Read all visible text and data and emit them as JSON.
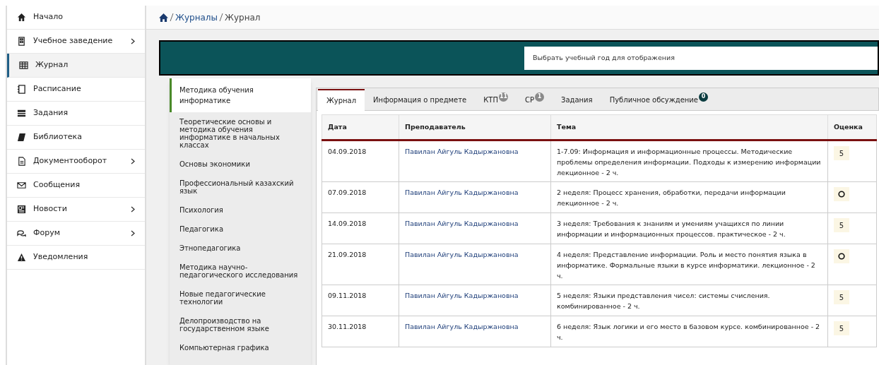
{
  "sidebar": {
    "items": [
      {
        "label": "Начало",
        "submenu": false,
        "selected": false
      },
      {
        "label": "Учебное заведение",
        "submenu": true,
        "selected": false
      },
      {
        "label": "Журнал",
        "submenu": false,
        "selected": true
      },
      {
        "label": "Расписание",
        "submenu": false,
        "selected": false
      },
      {
        "label": "Задания",
        "submenu": false,
        "selected": false
      },
      {
        "label": "Библиотека",
        "submenu": false,
        "selected": false
      },
      {
        "label": "Документооборот",
        "submenu": true,
        "selected": false
      },
      {
        "label": "Сообщения",
        "submenu": false,
        "selected": false
      },
      {
        "label": "Новости",
        "submenu": true,
        "selected": false
      },
      {
        "label": "Форум",
        "submenu": true,
        "selected": false
      },
      {
        "label": "Уведомления",
        "submenu": false,
        "selected": false
      }
    ]
  },
  "breadcrumb": {
    "links": [
      "Журналы"
    ],
    "current": "Журнал"
  },
  "year_select": {
    "placeholder": "Выбрать учебный год для отображения"
  },
  "subjects": [
    {
      "label": "Методика обучения информатике",
      "selected": true
    },
    {
      "label": "Теоретические основы и методика обучения информатике в начальных классах",
      "selected": false
    },
    {
      "label": "Основы экономики",
      "selected": false
    },
    {
      "label": "Профессиональный казахский язык",
      "selected": false
    },
    {
      "label": "Психология",
      "selected": false
    },
    {
      "label": "Педагогика",
      "selected": false
    },
    {
      "label": "Этнопедагогика",
      "selected": false
    },
    {
      "label": "Методика научно-педагогического исследования",
      "selected": false
    },
    {
      "label": "Новые педагогические технологии",
      "selected": false
    },
    {
      "label": "Делопроизводство на государственном языке",
      "selected": false
    },
    {
      "label": "Компьютерная графика",
      "selected": false
    }
  ],
  "tabs": [
    {
      "label": "Журнал",
      "selected": true
    },
    {
      "label": "Информация о предмете",
      "selected": false
    },
    {
      "label": "КТП",
      "selected": false,
      "badge": "11",
      "badge_muted": true
    },
    {
      "label": "СР",
      "selected": false,
      "badge": "1",
      "badge_muted": true
    },
    {
      "label": "Задания",
      "selected": false
    },
    {
      "label": "Публичное обсуждение",
      "selected": false,
      "badge": "0",
      "badge_muted": false
    }
  ],
  "table": {
    "columns": [
      "Дата",
      "Преподаватель",
      "Тема",
      "Оценка"
    ],
    "rows": [
      {
        "date": "04.09.2018",
        "teacher": "Павилан Айгуль Кадыржановна",
        "topic": "1-7.09: Информация и информационные процессы. Методические проблемы определения информации. Подходы к измерению информации лекционное - 2 ч.",
        "grade": "5",
        "kind": "mark"
      },
      {
        "date": "07.09.2018",
        "teacher": "Павилан Айгуль Кадыржановна",
        "topic": "2 неделя: Процесс хранения, обработки, передачи информации лекционное - 2 ч.",
        "kind": "ring"
      },
      {
        "date": "14.09.2018",
        "teacher": "Павилан Айгуль Кадыржановна",
        "topic": "3 неделя: Требования к знаниям и умениям учащихся по линии информации и информационных процессов. практическое - 2 ч.",
        "grade": "5",
        "kind": "mark"
      },
      {
        "date": "21.09.2018",
        "teacher": "Павилан Айгуль Кадыржановна",
        "topic": "4 неделя: Представление информации. Роль и место понятия языка в информатике. Формальные языки в курсе информатики. лекционное - 2 ч.",
        "kind": "ring"
      },
      {
        "date": "09.11.2018",
        "teacher": "Павилан Айгуль Кадыржановна",
        "topic": "5 неделя: Языки представления чисел: системы счисления. комбинированное - 2 ч.",
        "grade": "5",
        "kind": "mark"
      },
      {
        "date": "30.11.2018",
        "teacher": "Павилан Айгуль Кадыржановна",
        "topic": "6 неделя: Язык логики и его место в базовом курсе. комбинированное - 2 ч.",
        "grade": "5",
        "kind": "mark"
      }
    ]
  }
}
